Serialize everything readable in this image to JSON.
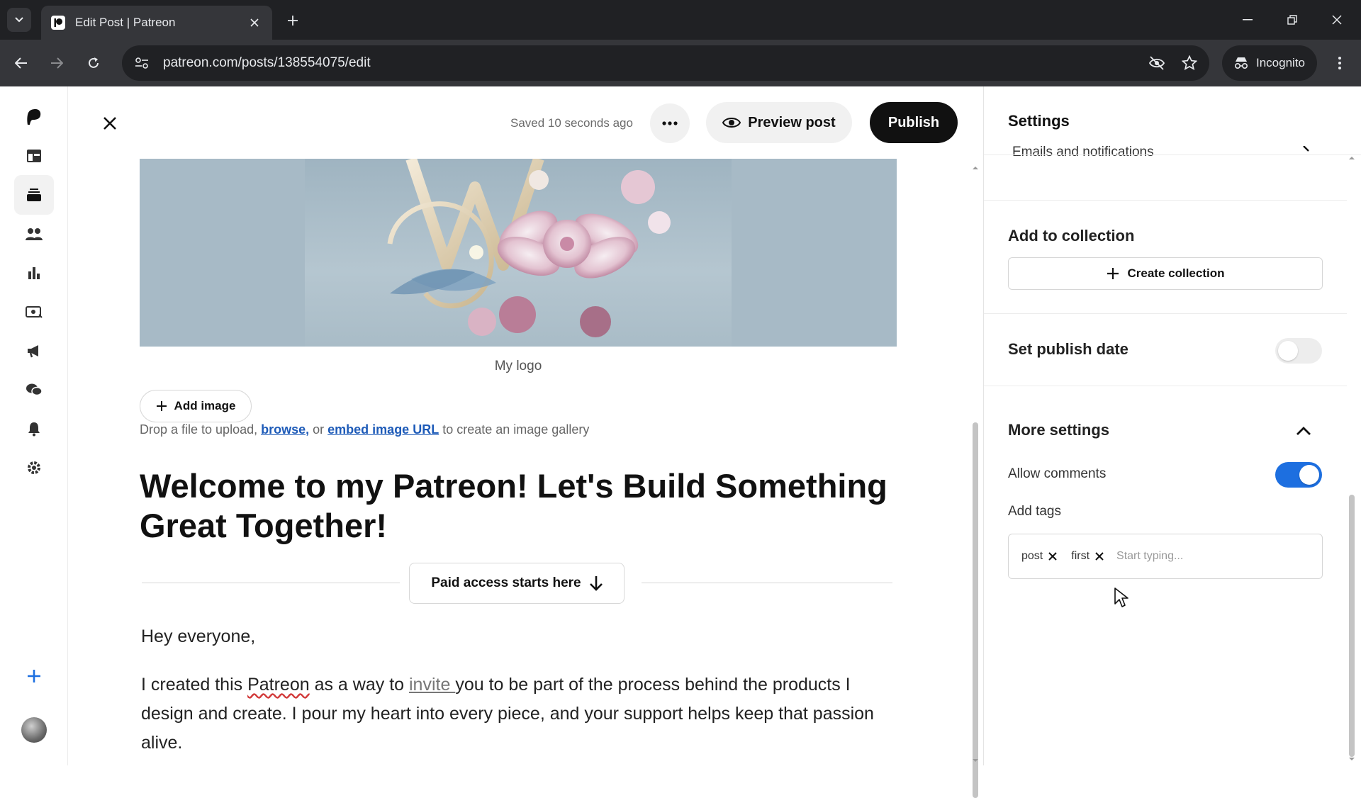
{
  "browser": {
    "tab_title": "Edit Post | Patreon",
    "url": "patreon.com/posts/138554075/edit",
    "incognito_label": "Incognito"
  },
  "rail": {
    "items": [
      "patreon-logo",
      "dashboard",
      "library",
      "audience",
      "insights",
      "payouts",
      "promotions",
      "chats",
      "notifications",
      "settings"
    ],
    "active": "library"
  },
  "editor": {
    "saved_status": "Saved 10 seconds ago",
    "preview_label": "Preview post",
    "publish_label": "Publish",
    "image_caption": "My logo",
    "add_image_label": "Add image",
    "drop_hint": {
      "prefix": "Drop a file to upload, ",
      "browse": "browse,",
      "middle": " or ",
      "embed": "embed image URL",
      "suffix": " to create an image gallery"
    },
    "title": "Welcome to my Patreon! Let's Build Something Great Together!",
    "paid_access_label": "Paid access starts here",
    "greeting": "Hey everyone,",
    "paragraph": {
      "p1": "I created this ",
      "w_patreon": "Patreon",
      "p2": " as a way to ",
      "w_invite": "invite ",
      "p3": "you to be part of the process behind the products I design and create. I pour my heart into every piece, and your support helps keep that passion alive."
    }
  },
  "settings": {
    "title": "Settings",
    "emails_row": "Emails and notifications",
    "add_to_collection": "Add to collection",
    "create_collection": "Create collection",
    "set_publish_date": "Set publish date",
    "publish_date_enabled": false,
    "more_settings": "More settings",
    "allow_comments": "Allow comments",
    "allow_comments_enabled": true,
    "add_tags": "Add tags",
    "tags": [
      "post",
      "first"
    ],
    "tags_placeholder": "Start typing..."
  },
  "colors": {
    "accent": "#1d6fe0",
    "link": "#1e5bb8",
    "publish_bg": "#111111"
  }
}
